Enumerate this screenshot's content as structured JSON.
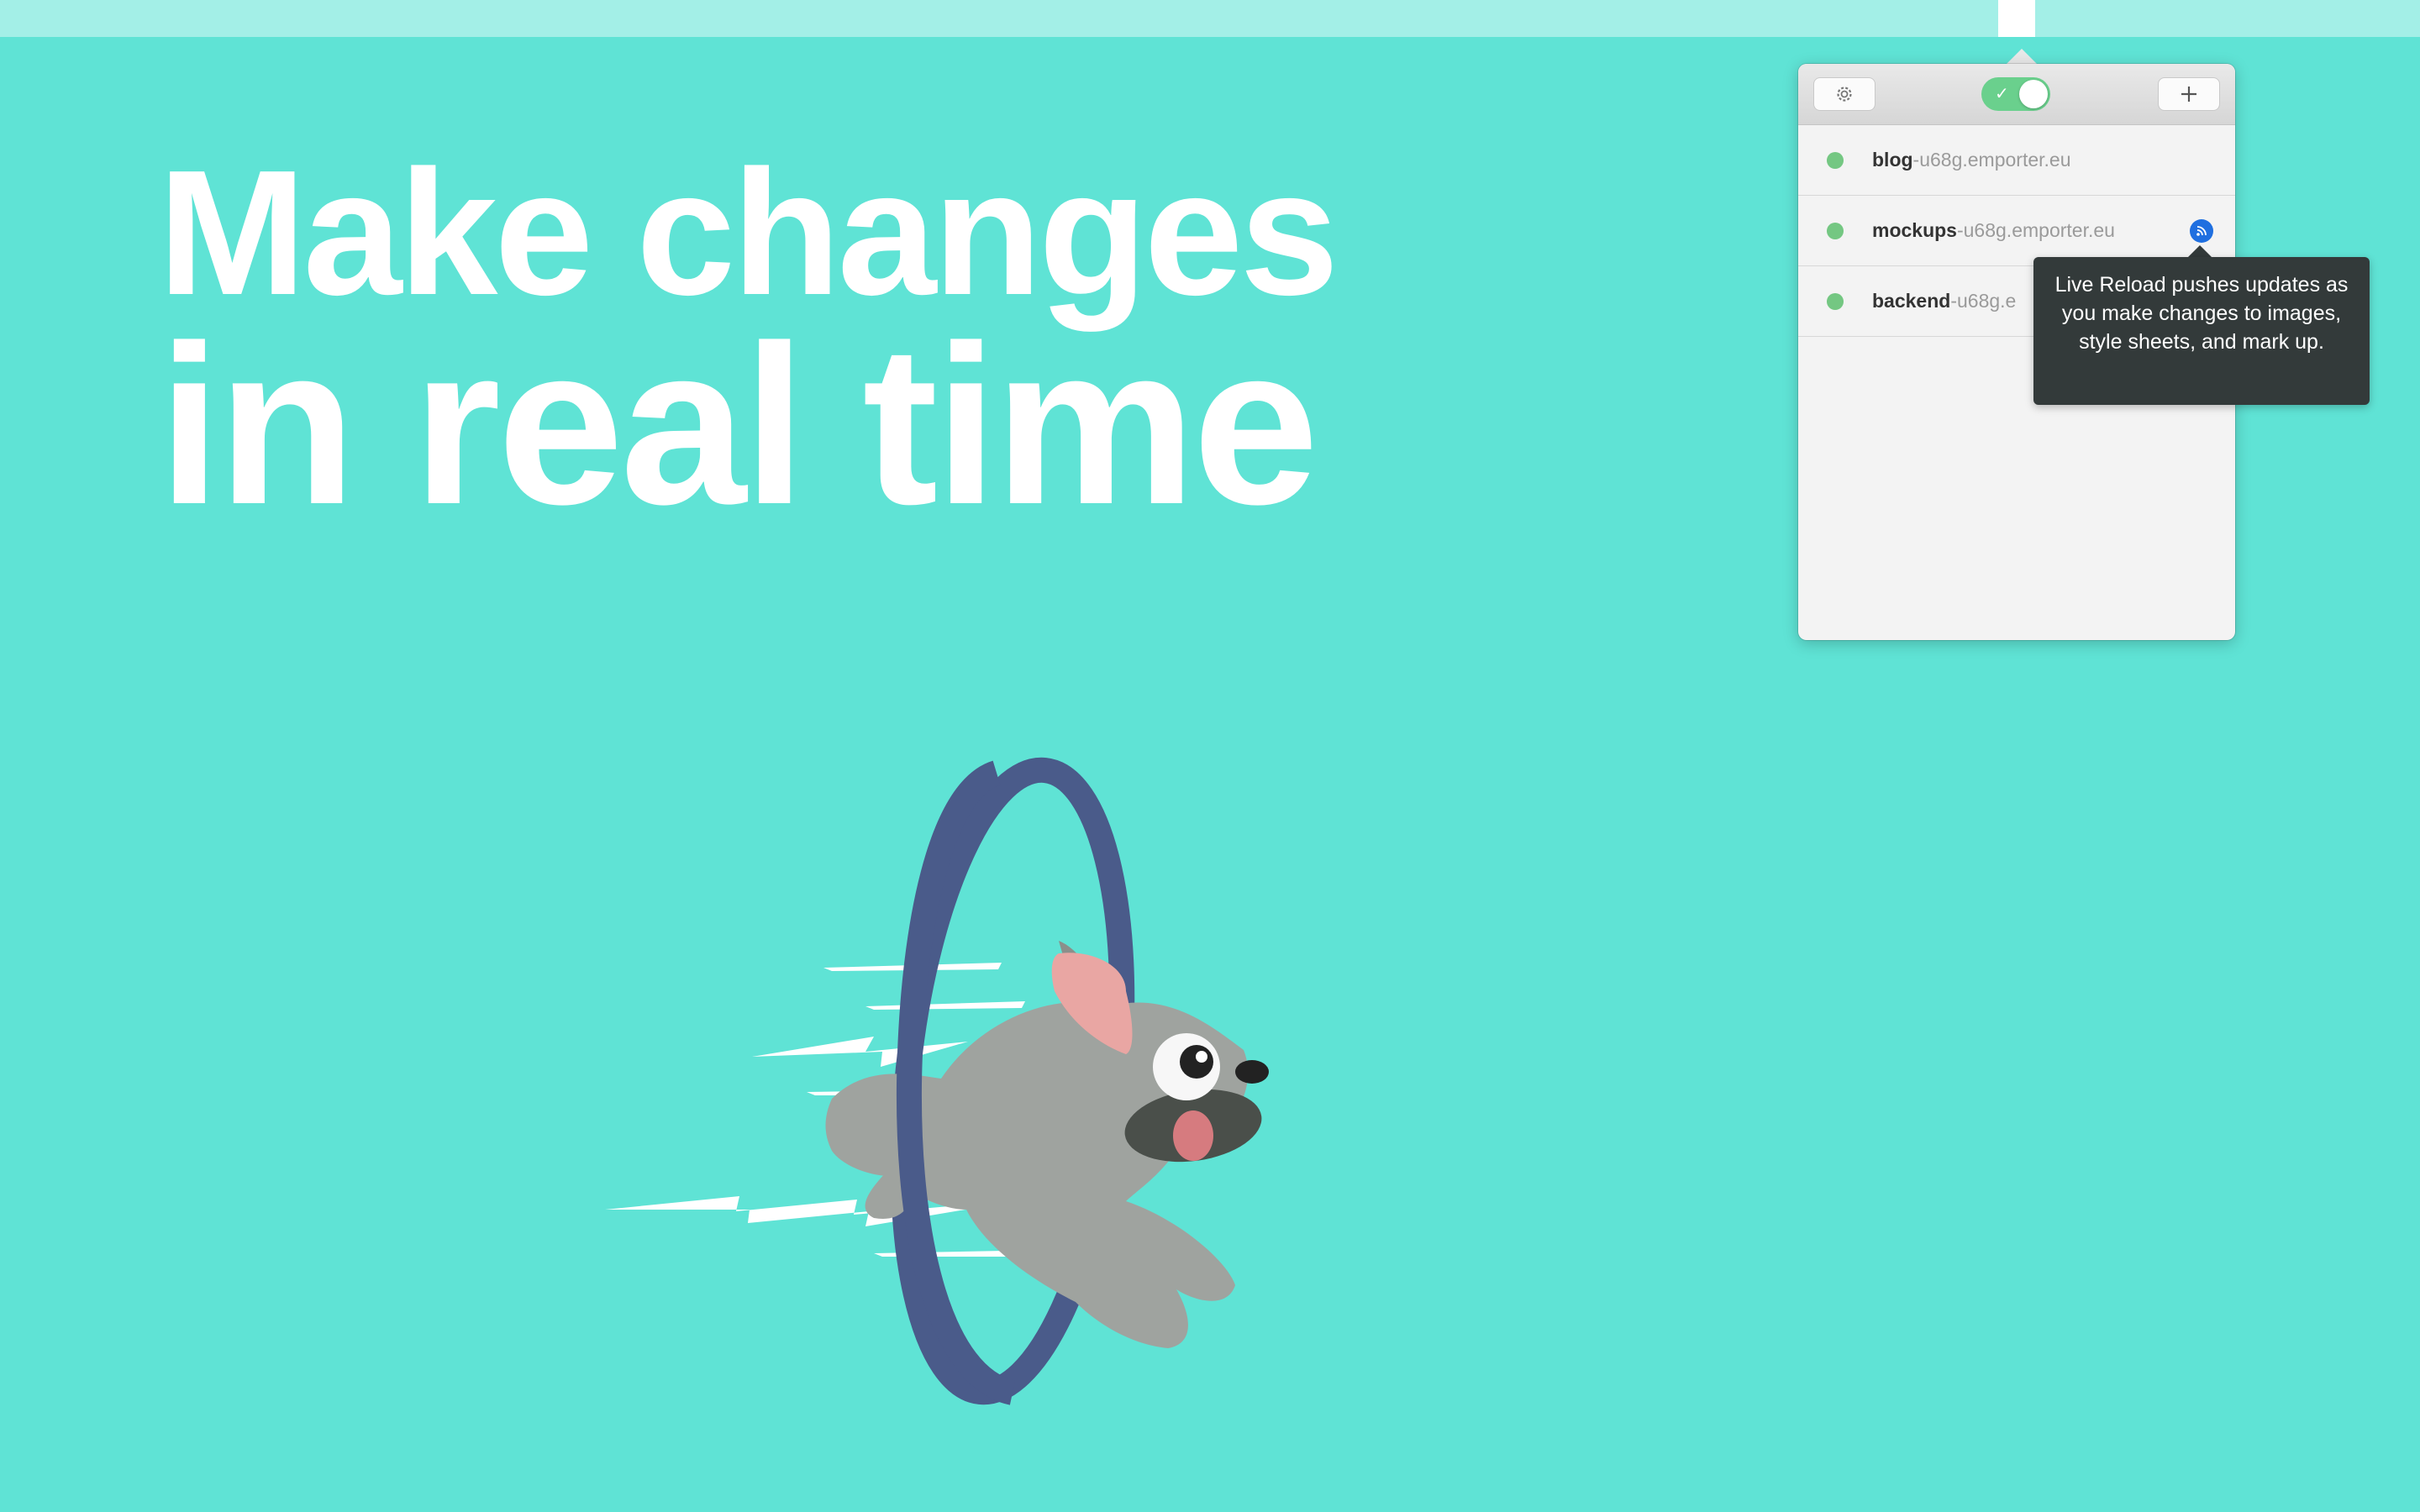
{
  "headline": {
    "line1": "Make changes",
    "line2": "in real time"
  },
  "popover": {
    "toolbar": {
      "settings_icon": "gear-icon",
      "live_reload_toggle": {
        "on": true,
        "icon": "checkmark-icon"
      },
      "add_icon": "plus-icon"
    },
    "sites": [
      {
        "name": "blog",
        "suffix": "-u68g.emporter.eu",
        "status": "online"
      },
      {
        "name": "mockups",
        "suffix": "-u68g.emporter.eu",
        "status": "online",
        "live_reload_icon": "live-reload-icon"
      },
      {
        "name": "backend",
        "suffix": "-u68g.e",
        "status": "online"
      }
    ],
    "tooltip": "Live Reload pushes updates as you make changes to images, style sheets, and mark up."
  },
  "colors": {
    "background": "#5fe3d5",
    "status_online": "#74c782",
    "toggle_on": "#6ad08d",
    "live_reload": "#1f6fe0",
    "hoop": "#4a5b8a"
  },
  "illustration": "dog-jumping-through-hoop"
}
